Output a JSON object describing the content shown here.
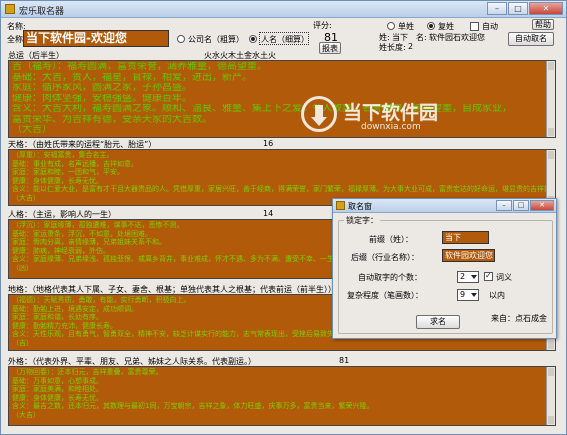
{
  "window": {
    "title": "宏乐取名器",
    "minimize": "–",
    "maximize": "□",
    "close": "✕"
  },
  "top": {
    "name_label": "名称:",
    "fullname_label": "全称:",
    "fullname_value": "当下软件园-欢迎您",
    "radio_company": "公司名（粗算）",
    "radio_person": "人名（细算）",
    "score_label": "评分:",
    "score_value": "81",
    "report_button": "报表",
    "single_surname": "单姓",
    "double_surname": "复姓",
    "auto_label": "自动",
    "help_button": "帮助",
    "surname_label": "姓:",
    "surname_value": "当下",
    "given_label": "名:",
    "given_value": "软件园石欢迎您",
    "surname_len_label": "姓长度:",
    "surname_len_value": "2",
    "auto_name_button": "自动取名"
  },
  "sections": [
    {
      "head": "总运（后半生）",
      "extra": "火水火木土金水土火",
      "lines": [
        "吉（福寿）：福寿圆满，富贵荣誉，涵养雅量，德高望重。",
        "基础：大吉，贵人，福星，官禄，相爱，进出，新产。",
        "家庭：循序家风，圆满之家，子孙昌盛。",
        "健康：肉体坚强，安稳强盛。健康百年。",
        "含义：大吉大利，福寿圆满之象。顺和、温良、雅量、集上下之爱。令人敬重。名誉福禄、德高望重，自成家业，",
        "富贵荣华、为吉祥有德，受亲天家的大吉数。",
        "（大吉）"
      ]
    },
    {
      "head": "天格：（由姓氏带来的运程“胎元、胎运”）",
      "extra": "16",
      "lines": [
        "（厚重）：安福富贵，集合名主。",
        "基础：事业有成，名声远播，吉祥如意。",
        "家庭：家庭和睦，一团和气，平安。",
        "健康：身体健康，长寿无忧。",
        "含义：能以仁爱大业，是富有才干且大器贵品的人。凭借厚重，家居兴旺，善于经商，得满荣誉，家门繁荣，福禄厚薄。为大事大业可成，富贵宏达的好命运，堪显贵的吉祥数。",
        "（大吉）"
      ]
    },
    {
      "head": "人格：（主运，影响人的一生）",
      "extra": "14",
      "lines": [
        "（浮沉）：家庭缘薄，孤独遭难，谋事不达，悲惨不测。",
        "基础：家运萧条，浮沉，不如意，处境困难。",
        "家庭：骨肉分离，亲情缘薄，兄弟姐妹关系不和。",
        "健康：肺病，神经衰弱，外伤。",
        "含义：家庭缘薄、兄弟缘浅、孤独悲恨、或离乡背井，事业难成，怀才不遇、多为不满、遭受不幸、一生难以安宁，",
        "（凶）"
      ]
    },
    {
      "head": "地格：（地格代表其人下属、子女、妻舍、根基；单独代表其人之根基；代表前运（前半生））",
      "extra": "",
      "lines": [
        "（福德）：天赋秀质，勇敢，有能，实行勇断，积极向上。",
        "基础：勤勉上进，境遇安定，成功顺调。",
        "家庭：家庭和谐，长幼有序。",
        "健康：勤勉精力充沛，健康长寿。",
        "含义：天性乐观，且有勇气，智勇双全，精神不安，缺乏计谋实行的能力，志气常表现出，受挫后易致失败。",
        "（吉）"
      ]
    },
    {
      "head": "外格：（代表外界、平辈、朋友、兄弟、姊妹之人际关系。代表副运。）",
      "extra": "81",
      "lines": [
        "（万物回春）：还本归元，吉祥重叠，富贵尊荣。",
        "基础：万事如意，心想事成。",
        "家庭：家庭美满，和睦相处。",
        "健康：身体健康，长寿无忧。",
        "含义：最吉之数，还本归元，其数理与最初1同，万宝朝宗，吉祥之象，体力旺盛，庆事万多，富贵当来，繁荣兴隆。",
        "（大吉）"
      ]
    }
  ],
  "watermark": {
    "text": "当下软件园",
    "url": "downxia.com"
  },
  "dialog": {
    "title": "取名窗",
    "group_title": "锁定字：",
    "prefix_label": "前缀（姓）：",
    "prefix_value": "当下",
    "suffix_label": "后缀（行业名称）：",
    "suffix_value": "软件园欢迎您",
    "count_label": "自动取字的个数：",
    "count_value": "2",
    "word_sense_label": "词义",
    "complexity_label": "复杂程度（笔画数）：",
    "complexity_value": "9",
    "within_label": "以内",
    "go_button": "求名",
    "source_label": "来自：点石成金"
  },
  "colors": {
    "panel_bg": "#b05a0a",
    "panel_text": "#62c800"
  }
}
